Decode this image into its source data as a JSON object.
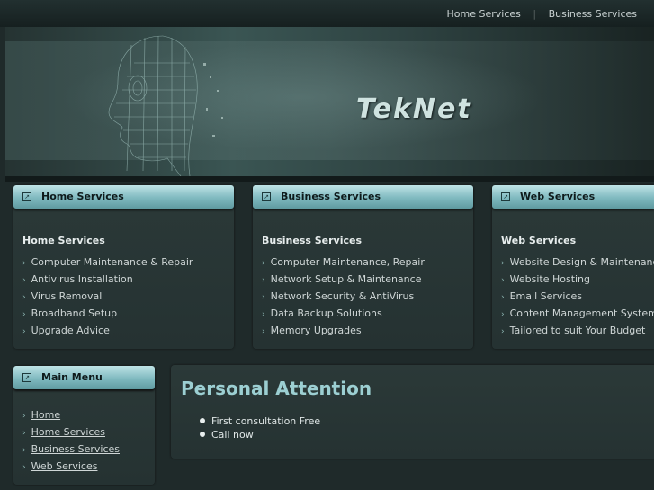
{
  "top_nav": {
    "links": [
      "Home Services",
      "Business Services"
    ]
  },
  "header": {
    "logo": "TekNet"
  },
  "panels": [
    {
      "title": "Home Services",
      "subtitle": "Home Services",
      "items": [
        "Computer Maintenance & Repair",
        "Antivirus Installation",
        "Virus Removal",
        "Broadband Setup",
        "Upgrade Advice"
      ]
    },
    {
      "title": "Business Services",
      "subtitle": "Business Services",
      "items": [
        "Computer Maintenance, Repair",
        "Network Setup & Maintenance",
        "Network Security & AntiVirus",
        "Data Backup Solutions",
        "Memory Upgrades"
      ]
    },
    {
      "title": "Web Services",
      "subtitle": "Web Services",
      "items": [
        "Website Design & Maintenance",
        "Website Hosting",
        "Email Services",
        "Content Management System (C",
        "Tailored to suit Your Budget"
      ]
    }
  ],
  "main_menu": {
    "title": "Main Menu",
    "items": [
      "Home",
      "Home Services",
      "Business Services",
      "Web Services"
    ]
  },
  "content": {
    "heading": "Personal Attention",
    "items": [
      "First consultation Free",
      "Call now"
    ]
  },
  "colors": {
    "accent": "#7fb9bf",
    "heading": "#9ccfd2",
    "background": "#1f2a2a"
  }
}
